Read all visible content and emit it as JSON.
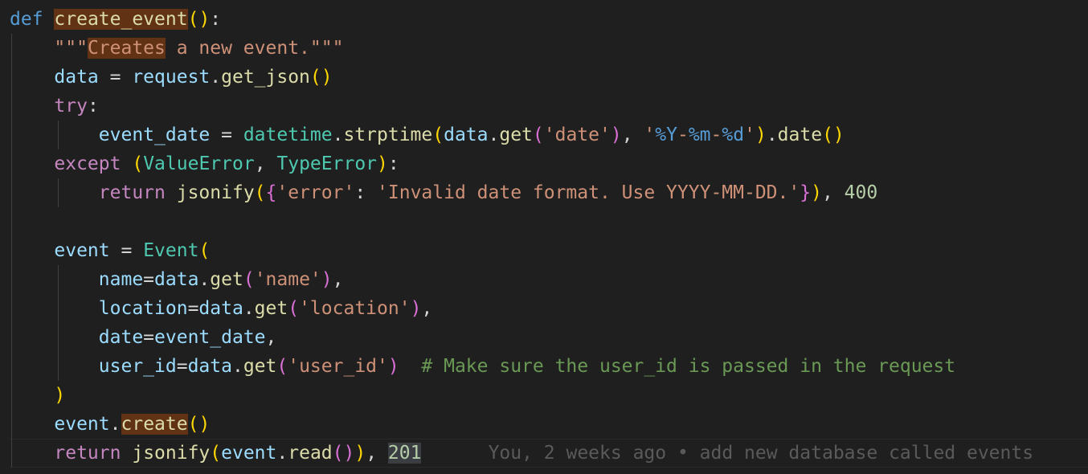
{
  "editor": {
    "top_fragment": "··",
    "lines": [
      {
        "tokens": [
          [
            "def",
            "kw"
          ],
          [
            " ",
            "op"
          ],
          [
            "create_event",
            "fn hl"
          ],
          [
            "(",
            "b1"
          ],
          [
            ")",
            "b1"
          ],
          [
            ":",
            "op"
          ]
        ]
      },
      {
        "tokens": [
          [
            "\"\"\"",
            "str"
          ],
          [
            "Creates",
            "str hl"
          ],
          [
            " a new event.\"\"\"",
            "str"
          ]
        ]
      },
      {
        "tokens": [
          [
            "data",
            "var"
          ],
          [
            " = ",
            "op"
          ],
          [
            "request",
            "var"
          ],
          [
            ".",
            "op"
          ],
          [
            "get_json",
            "fn"
          ],
          [
            "(",
            "b1"
          ],
          [
            ")",
            "b1"
          ]
        ]
      },
      {
        "tokens": [
          [
            "try",
            "ctl"
          ],
          [
            ":",
            "op"
          ]
        ]
      },
      {
        "tokens": [
          [
            "event_date",
            "var"
          ],
          [
            " = ",
            "op"
          ],
          [
            "datetime",
            "cls"
          ],
          [
            ".",
            "op"
          ],
          [
            "strptime",
            "fn"
          ],
          [
            "(",
            "b1"
          ],
          [
            "data",
            "var"
          ],
          [
            ".",
            "op"
          ],
          [
            "get",
            "fn"
          ],
          [
            "(",
            "b2"
          ],
          [
            "'date'",
            "str"
          ],
          [
            ")",
            "b2"
          ],
          [
            ", ",
            "op"
          ],
          [
            "'",
            "str"
          ],
          [
            "%Y",
            "fmt"
          ],
          [
            "-",
            "str"
          ],
          [
            "%m",
            "fmt"
          ],
          [
            "-",
            "str"
          ],
          [
            "%d",
            "fmt"
          ],
          [
            "'",
            "str"
          ],
          [
            ")",
            "b1"
          ],
          [
            ".",
            "op"
          ],
          [
            "date",
            "fn"
          ],
          [
            "(",
            "b1"
          ],
          [
            ")",
            "b1"
          ]
        ]
      },
      {
        "tokens": [
          [
            "except",
            "ctl"
          ],
          [
            " ",
            "op"
          ],
          [
            "(",
            "b1"
          ],
          [
            "ValueError",
            "cls"
          ],
          [
            ", ",
            "op"
          ],
          [
            "TypeError",
            "cls"
          ],
          [
            ")",
            "b1"
          ],
          [
            ":",
            "op"
          ]
        ]
      },
      {
        "tokens": [
          [
            "return",
            "ctl"
          ],
          [
            " ",
            "op"
          ],
          [
            "jsonify",
            "fn"
          ],
          [
            "(",
            "b1"
          ],
          [
            "{",
            "b2"
          ],
          [
            "'error'",
            "str"
          ],
          [
            ": ",
            "op"
          ],
          [
            "'Invalid date format. Use YYYY-MM-DD.'",
            "str"
          ],
          [
            "}",
            "b2"
          ],
          [
            ")",
            "b1"
          ],
          [
            ", ",
            "op"
          ],
          [
            "400",
            "num"
          ]
        ]
      },
      {
        "tokens": []
      },
      {
        "tokens": [
          [
            "event",
            "var"
          ],
          [
            " = ",
            "op"
          ],
          [
            "Event",
            "cls"
          ],
          [
            "(",
            "b1"
          ]
        ]
      },
      {
        "tokens": [
          [
            "name",
            "var"
          ],
          [
            "=",
            "op"
          ],
          [
            "data",
            "var"
          ],
          [
            ".",
            "op"
          ],
          [
            "get",
            "fn"
          ],
          [
            "(",
            "b2"
          ],
          [
            "'name'",
            "str"
          ],
          [
            ")",
            "b2"
          ],
          [
            ",",
            "op"
          ]
        ]
      },
      {
        "tokens": [
          [
            "location",
            "var"
          ],
          [
            "=",
            "op"
          ],
          [
            "data",
            "var"
          ],
          [
            ".",
            "op"
          ],
          [
            "get",
            "fn"
          ],
          [
            "(",
            "b2"
          ],
          [
            "'location'",
            "str"
          ],
          [
            ")",
            "b2"
          ],
          [
            ",",
            "op"
          ]
        ]
      },
      {
        "tokens": [
          [
            "date",
            "var"
          ],
          [
            "=",
            "op"
          ],
          [
            "event_date",
            "var"
          ],
          [
            ",",
            "op"
          ]
        ]
      },
      {
        "tokens": [
          [
            "user_id",
            "var"
          ],
          [
            "=",
            "op"
          ],
          [
            "data",
            "var"
          ],
          [
            ".",
            "op"
          ],
          [
            "get",
            "fn"
          ],
          [
            "(",
            "b2"
          ],
          [
            "'user_id'",
            "str"
          ],
          [
            ")",
            "b2"
          ],
          [
            "  ",
            "op"
          ],
          [
            "# Make sure the user_id is passed in the request",
            "cmt"
          ]
        ]
      },
      {
        "tokens": [
          [
            ")",
            "b1"
          ]
        ]
      },
      {
        "tokens": [
          [
            "event",
            "var"
          ],
          [
            ".",
            "op"
          ],
          [
            "create",
            "fn hl"
          ],
          [
            "(",
            "b1"
          ],
          [
            ")",
            "b1"
          ]
        ]
      },
      {
        "tokens": [
          [
            "return",
            "ctl"
          ],
          [
            " ",
            "op"
          ],
          [
            "jsonify",
            "fn"
          ],
          [
            "(",
            "b1"
          ],
          [
            "event",
            "var"
          ],
          [
            ".",
            "op"
          ],
          [
            "read",
            "fn"
          ],
          [
            "(",
            "b2"
          ],
          [
            ")",
            "b2"
          ],
          [
            ")",
            "b1"
          ],
          [
            ", ",
            "op"
          ],
          [
            "201",
            "num hl-sel"
          ]
        ]
      }
    ],
    "blame": "You, 2 weeks ago • add new database called events"
  }
}
